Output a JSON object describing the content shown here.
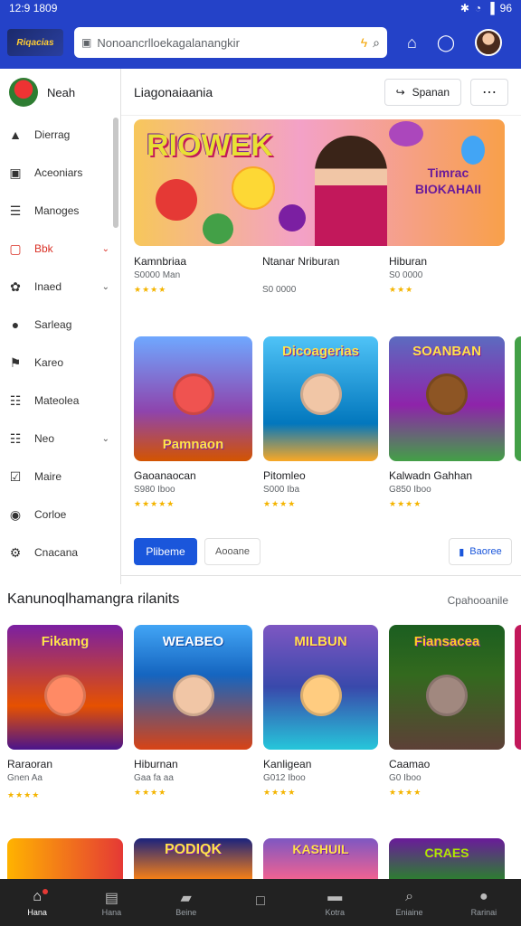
{
  "status": {
    "time": "12:9 1809",
    "battery": "96"
  },
  "header": {
    "logo_text": "Riqacias",
    "search_text": "Nonoancrlloekagalanangkir",
    "colors": {
      "brand": "#2442c8",
      "primary": "#1a56db"
    }
  },
  "sidebar": {
    "user": "Neah",
    "items": [
      {
        "label": "Dierrag",
        "icon": "person-icon"
      },
      {
        "label": "Aceoniars",
        "icon": "photo-icon"
      },
      {
        "label": "Manoges",
        "icon": "list-icon"
      },
      {
        "label": "Bbk",
        "icon": "book-icon",
        "chevron": true,
        "highlight": true
      },
      {
        "label": "Inaed",
        "icon": "puzzle-icon",
        "chevron": true
      },
      {
        "label": "Sarleag",
        "icon": "user-icon"
      },
      {
        "label": "Kareo",
        "icon": "flag-icon"
      },
      {
        "label": "Mateolea",
        "icon": "doc-icon"
      },
      {
        "label": "Neo",
        "icon": "grid-icon",
        "chevron": true
      },
      {
        "label": "Maire",
        "icon": "check-icon"
      },
      {
        "label": "Corloe",
        "icon": "pin-icon"
      },
      {
        "label": "Cnacana",
        "icon": "gear-icon"
      }
    ]
  },
  "panel": {
    "title": "Liagonaiaania",
    "share_label": "Spanan",
    "more_label": "⋯",
    "banner": {
      "title": "RIOWEK",
      "subtitle_1": "Timrac",
      "subtitle_2": "BIOKAHAII"
    },
    "row1": [
      {
        "title": "Kamnbriaa",
        "sub": "S0000 Man",
        "stars": "★★★★"
      },
      {
        "title": "Ntanar Nriburan",
        "sub": "S0 0000",
        "stars": ""
      },
      {
        "title": "Hiburan",
        "sub": "S0 0000",
        "stars": "★★★"
      }
    ],
    "row2": [
      {
        "title": "Gaoanaocan",
        "sub": "S980 Iboo",
        "stars": "★★★★★",
        "art": "Pamnaon"
      },
      {
        "title": "Pitomleo",
        "sub": "S000 Iba",
        "stars": "★★★★",
        "art": "Dicoagerias"
      },
      {
        "title": "Kalwadn Gahhan",
        "sub": "G850 Iboo",
        "stars": "★★★★",
        "art": "SOANBAN"
      }
    ],
    "primary_btn": "Plibeme",
    "secondary_btn": "Aooane",
    "right_btn": "Baoree"
  },
  "section2": {
    "title": "Kanunoqlhamangra rilanits",
    "link": "Cpahooanile",
    "cards": [
      {
        "title": "Raraoran",
        "sub": "Gnen Aa",
        "stars": "★★★★",
        "art": "Fikamg"
      },
      {
        "title": "Hiburnan",
        "sub": "Gaa fa aa",
        "stars": "★★★★",
        "art": "WEABEO"
      },
      {
        "title": "Kanligean",
        "sub": "G012 Iboo",
        "stars": "★★★★",
        "art": "MILBUN"
      },
      {
        "title": "Caamao",
        "sub": "G0 Iboo",
        "stars": "★★★★",
        "art": "Fiansacea"
      }
    ],
    "row_next": [
      "PODIQK",
      "KASHUIL",
      "CRAES"
    ]
  },
  "bottom_nav": [
    {
      "label": "Hana",
      "active": true
    },
    {
      "label": "Hana"
    },
    {
      "label": "Beine"
    },
    {
      "label": ""
    },
    {
      "label": "Kotra"
    },
    {
      "label": "Eniaine"
    },
    {
      "label": "Rarinai"
    }
  ]
}
